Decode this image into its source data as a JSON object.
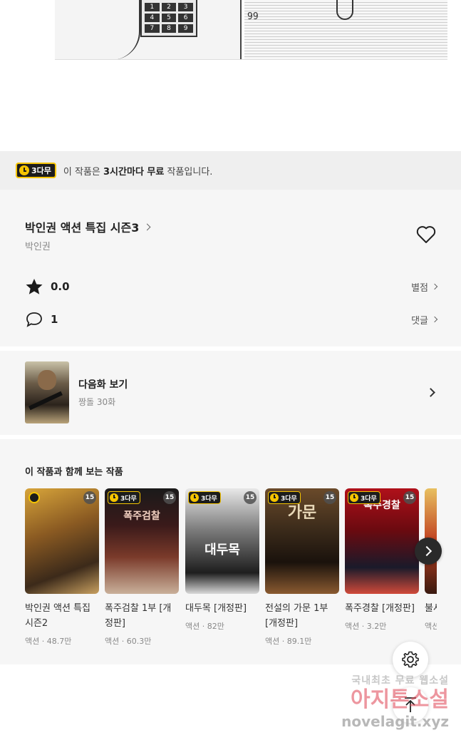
{
  "comic": {
    "keypad_keys": [
      "1",
      "2",
      "3",
      "4",
      "5",
      "6",
      "7",
      "8",
      "9"
    ],
    "caption": "99"
  },
  "notice": {
    "badge": "3다무",
    "message_prefix": "이 작품은 ",
    "message_bold": "3시간마다 무료",
    "message_suffix": " 작품입니다."
  },
  "work": {
    "title": "박인권 액션 특집 시즌3",
    "author": "박인권",
    "rating": "0.0",
    "rating_link": "별점",
    "comments": "1",
    "comments_link": "댓글"
  },
  "next_episode": {
    "label": "다음화 보기",
    "subtitle": "짱돌 30화"
  },
  "related": {
    "heading": "이 작품과 함께 보는 작품",
    "cards": [
      {
        "title": "박인권 액션 특집 시즌2",
        "meta": "액션 · 48.7만",
        "age": "15",
        "badge": "",
        "cover_tag": ""
      },
      {
        "title": "폭주검찰 1부 [개정판]",
        "meta": "액션 · 60.3만",
        "age": "15",
        "badge": "3다무",
        "cover_tag": "폭주검찰"
      },
      {
        "title": "대두목 [개정판]",
        "meta": "액션 · 82만",
        "age": "15",
        "badge": "3다무",
        "cover_tag": "대두목"
      },
      {
        "title": "전설의 가문 1부 [개정판]",
        "meta": "액션 · 89.1만",
        "age": "15",
        "badge": "3다무",
        "cover_tag": "가문"
      },
      {
        "title": "폭주경찰 [개정판]",
        "meta": "액션 · 3.2만",
        "age": "15",
        "badge": "3다무",
        "cover_tag": "폭주경찰"
      },
      {
        "title": "불사",
        "meta": "액션",
        "age": "",
        "badge": "",
        "cover_tag": ""
      }
    ]
  },
  "watermark": {
    "line1": "국내최초 무료 웹소설",
    "line2": "아지톤소설",
    "line3": "novelagit.xyz"
  },
  "colors": {
    "badge_bg": "#1c1c1c",
    "badge_accent": "#f5c400",
    "section_bg": "#f6f6f6"
  }
}
